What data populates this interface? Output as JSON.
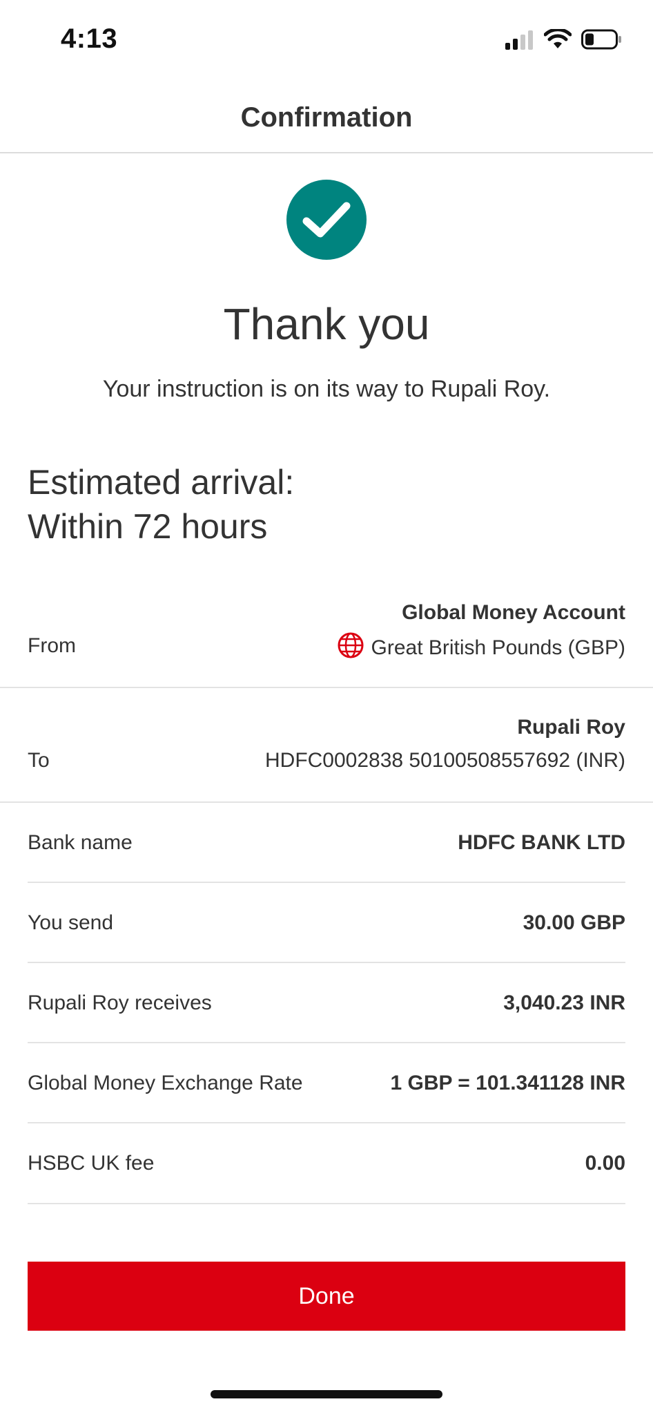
{
  "status_bar": {
    "time": "4:13",
    "icons": [
      "signal-icon",
      "wifi-icon",
      "battery-icon"
    ]
  },
  "header": {
    "title": "Confirmation"
  },
  "success": {
    "icon": "check-circle-icon",
    "color": "#00847f",
    "title": "Thank you",
    "message": "Your instruction is on its way to Rupali Roy."
  },
  "arrival": {
    "line1": "Estimated arrival:",
    "line2": "Within 72 hours"
  },
  "from": {
    "label": "From",
    "account_name": "Global Money Account",
    "currency_icon": "globe-icon",
    "currency": "Great British Pounds (GBP)"
  },
  "to": {
    "label": "To",
    "payee": "Rupali Roy",
    "account": "HDFC0002838 50100508557692 (INR)"
  },
  "details": [
    {
      "label": "Bank name",
      "value": "HDFC BANK LTD"
    },
    {
      "label": "You send",
      "value": "30.00 GBP"
    },
    {
      "label": "Rupali Roy receives",
      "value": "3,040.23 INR"
    },
    {
      "label": "Global Money Exchange Rate",
      "value": "1 GBP = 101.341128 INR"
    },
    {
      "label": "HSBC UK fee",
      "value": "0.00"
    }
  ],
  "actions": {
    "done_label": "Done",
    "done_color": "#db0011"
  }
}
